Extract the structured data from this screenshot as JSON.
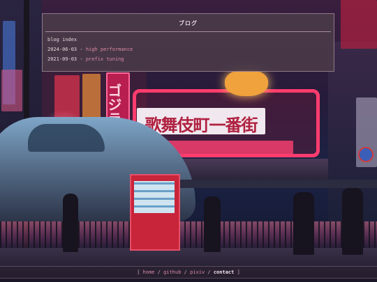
{
  "blog": {
    "title": "ブログ",
    "index_label": "blog index",
    "posts": [
      {
        "date": "2024-06-03",
        "sep": " - ",
        "title": "high performance"
      },
      {
        "date": "2021-09-03",
        "sep": " - ",
        "title": "prefix tuning"
      }
    ]
  },
  "scene": {
    "sign_text": "歌舞伎町一番街",
    "vertical_sign": "ゴジラ",
    "colors": {
      "neon_pink": "#ff3c6e",
      "neon_red": "#e0304a",
      "lantern": "#f0a23c",
      "vending_red": "#c8243a"
    }
  },
  "footer": {
    "open_bracket": "[",
    "close_bracket": "]",
    "sep": "/",
    "links": [
      "home",
      "github",
      "pixiv",
      "contact"
    ],
    "active": "contact"
  }
}
